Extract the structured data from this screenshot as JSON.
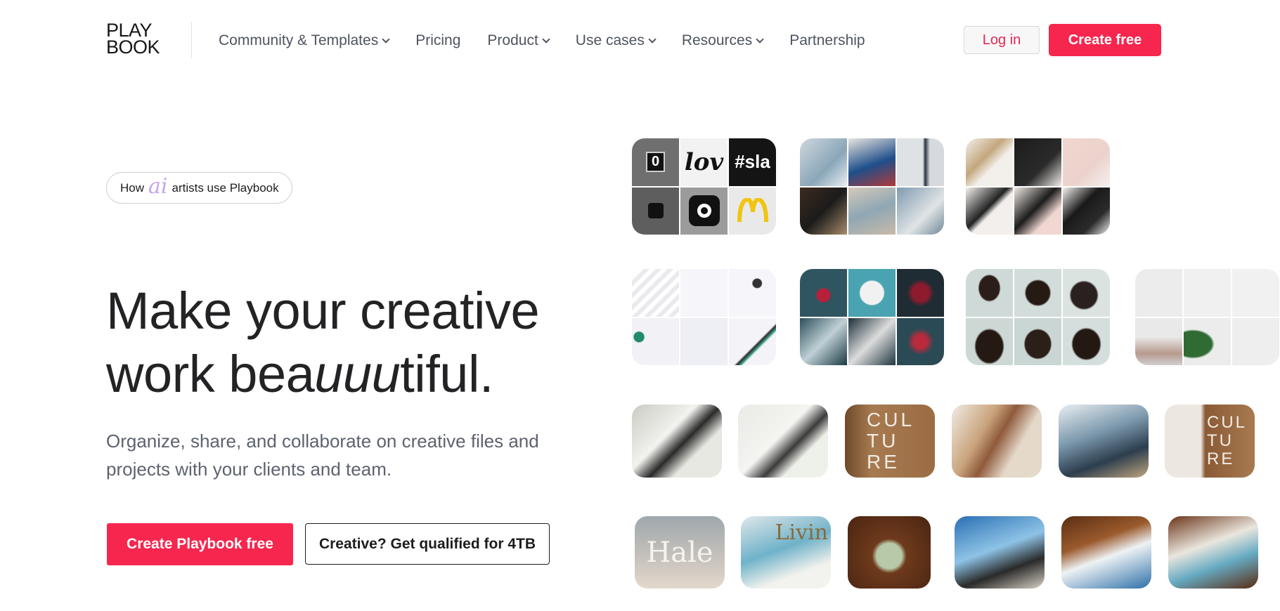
{
  "brand": {
    "logo_line1": "PLAY",
    "logo_line2": "BOOK",
    "accent": "#f6264e"
  },
  "nav": {
    "links": [
      {
        "label": "Community & Templates",
        "dropdown": true
      },
      {
        "label": "Pricing",
        "dropdown": false
      },
      {
        "label": "Product",
        "dropdown": true
      },
      {
        "label": "Use cases",
        "dropdown": true
      },
      {
        "label": "Resources",
        "dropdown": true
      },
      {
        "label": "Partnership",
        "dropdown": false
      }
    ],
    "login_label": "Log in",
    "create_label": "Create free"
  },
  "hero": {
    "pill_prefix": "How",
    "pill_ai": "ai",
    "pill_suffix": "artists use Playbook",
    "headline_line1": "Make your creative",
    "headline_line2_a": "work bea",
    "headline_line2_b": "uuu",
    "headline_line2_c": "tiful.",
    "subheading": "Organize, share, and collaborate on creative files and projects with your clients and team.",
    "cta_primary": "Create Playbook free",
    "cta_secondary": "Creative? Get qualified for 4TB"
  },
  "gallery": {
    "logo_tile_text": [
      "0",
      "lov",
      "#sla"
    ],
    "culture_text": "CUL TU RE",
    "hale_text": "Hale",
    "living_text": "Livin"
  }
}
